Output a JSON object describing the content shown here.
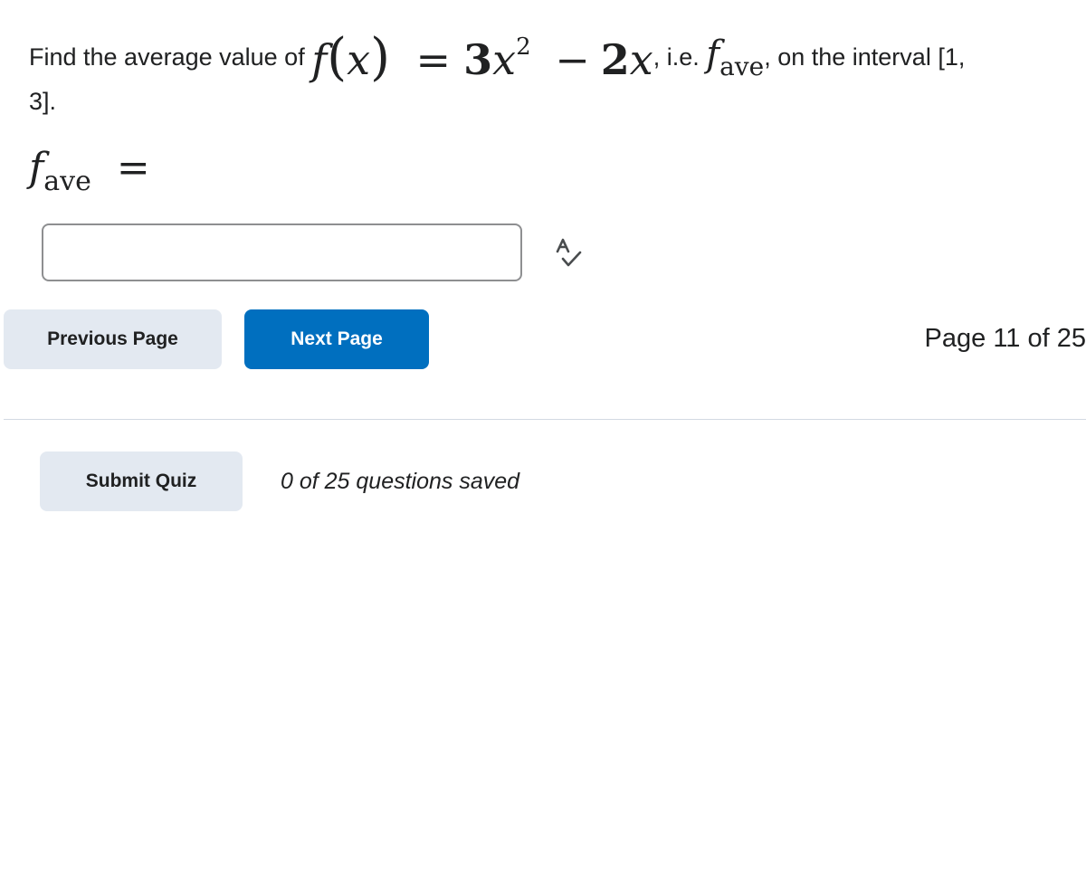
{
  "question": {
    "prefix": "Find the average value of",
    "func_name": "f",
    "func_arg": "x",
    "equals": "=",
    "coef1": "3",
    "var1": "x",
    "exp1": "2",
    "minus": "−",
    "coef2": "2",
    "var2": "x",
    "ie_text": ", i.e.",
    "fave_f": "f",
    "fave_sub": "ave",
    "interval_text": ", on the interval [1,",
    "interval_end": "3]."
  },
  "answer": {
    "label_f": "f",
    "label_sub": "ave",
    "label_equals": "=",
    "value": "",
    "placeholder": ""
  },
  "icons": {
    "spellcheck": "spellcheck-icon"
  },
  "navigation": {
    "previous_label": "Previous Page",
    "next_label": "Next Page",
    "page_indicator": "Page 11 of 25",
    "current_page": 11,
    "total_pages": 25
  },
  "footer": {
    "submit_label": "Submit Quiz",
    "saved_status": "0 of 25 questions saved"
  },
  "colors": {
    "primary": "#006fbf",
    "secondary": "#e3e9f1",
    "text": "#202122"
  }
}
